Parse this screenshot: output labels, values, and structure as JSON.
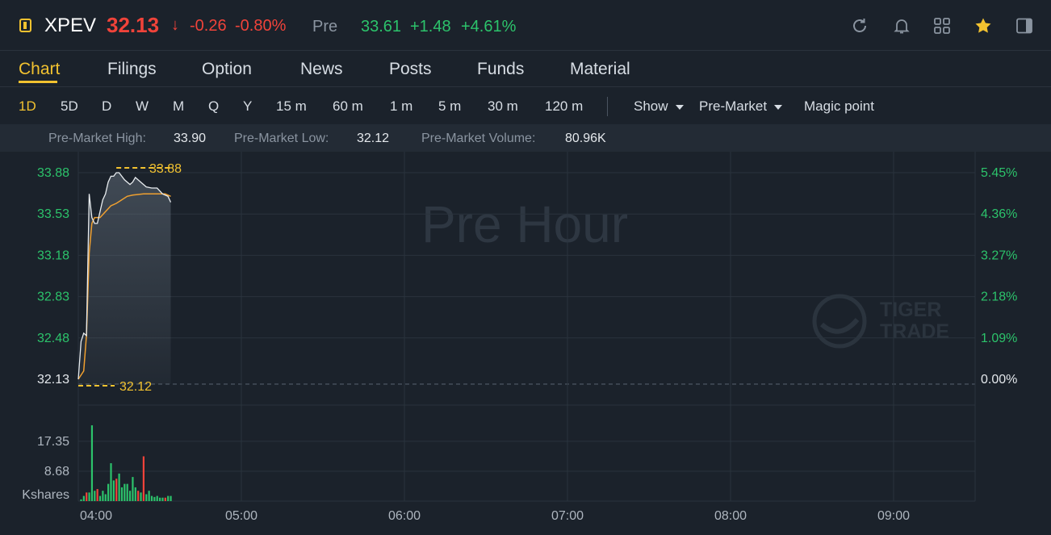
{
  "header": {
    "symbol": "XPEV",
    "price": "32.13",
    "price_arrow": "↓",
    "change": "-0.26",
    "change_pct": "-0.80%",
    "session_label": "Pre",
    "pre_price": "33.61",
    "pre_change": "+1.48",
    "pre_change_pct": "+4.61%",
    "icons": [
      "refresh-icon",
      "bell-icon",
      "grid-icon",
      "star-icon",
      "sidebar-toggle-icon"
    ]
  },
  "tabs": [
    "Chart",
    "Filings",
    "Option",
    "News",
    "Posts",
    "Funds",
    "Material"
  ],
  "active_tab": "Chart",
  "periods": [
    "1D",
    "5D",
    "D",
    "W",
    "M",
    "Q",
    "Y",
    "15 m",
    "60 m",
    "1 m",
    "5 m",
    "30 m",
    "120 m"
  ],
  "active_period": "1D",
  "controls": {
    "show": "Show",
    "session": "Pre-Market",
    "magic": "Magic point"
  },
  "stats": {
    "high_label": "Pre-Market High:",
    "high_value": "33.90",
    "low_label": "Pre-Market Low:",
    "low_value": "32.12",
    "volume_label": "Pre-Market Volume:",
    "volume_value": "80.96K"
  },
  "watermark": "Pre Hour",
  "logo_text": [
    "TIGER",
    "TRADE"
  ],
  "colors": {
    "up": "#2cc36b",
    "down": "#f0433a",
    "accent": "#f2c230",
    "background": "#1b222b",
    "avg_line": "#f0a030"
  },
  "chart_data": {
    "type": "line",
    "x_ticks": [
      "04:00",
      "05:00",
      "06:00",
      "07:00",
      "08:00",
      "09:00"
    ],
    "y_ticks": [
      "33.88",
      "33.53",
      "33.18",
      "32.83",
      "32.48",
      "32.13"
    ],
    "pct_ticks": [
      "5.45%",
      "4.36%",
      "3.27%",
      "2.18%",
      "1.09%",
      "0.00%"
    ],
    "ylim": [
      32.13,
      33.88
    ],
    "xlim_minutes": [
      0,
      330
    ],
    "high_marker": "33.88",
    "low_marker": "32.12",
    "series": [
      {
        "name": "price",
        "points": [
          [
            0,
            32.13
          ],
          [
            1,
            32.45
          ],
          [
            2,
            32.52
          ],
          [
            3,
            32.5
          ],
          [
            4,
            33.7
          ],
          [
            5,
            33.5
          ],
          [
            6,
            33.45
          ],
          [
            7,
            33.45
          ],
          [
            8,
            33.55
          ],
          [
            9,
            33.65
          ],
          [
            10,
            33.7
          ],
          [
            11,
            33.8
          ],
          [
            12,
            33.85
          ],
          [
            13,
            33.85
          ],
          [
            14,
            33.88
          ],
          [
            15,
            33.88
          ],
          [
            17,
            33.82
          ],
          [
            19,
            33.78
          ],
          [
            20,
            33.8
          ],
          [
            21,
            33.84
          ],
          [
            23,
            33.8
          ],
          [
            25,
            33.76
          ],
          [
            27,
            33.75
          ],
          [
            29,
            33.75
          ],
          [
            31,
            33.7
          ],
          [
            33,
            33.68
          ],
          [
            34,
            33.63
          ]
        ]
      },
      {
        "name": "average",
        "points": [
          [
            0,
            32.13
          ],
          [
            2,
            32.2
          ],
          [
            3,
            32.5
          ],
          [
            4,
            33.2
          ],
          [
            5,
            33.45
          ],
          [
            6,
            33.5
          ],
          [
            8,
            33.5
          ],
          [
            10,
            33.55
          ],
          [
            12,
            33.6
          ],
          [
            14,
            33.62
          ],
          [
            16,
            33.65
          ],
          [
            18,
            33.68
          ],
          [
            20,
            33.69
          ],
          [
            24,
            33.7
          ],
          [
            28,
            33.7
          ],
          [
            32,
            33.7
          ],
          [
            34,
            33.68
          ]
        ]
      }
    ],
    "volume": {
      "label": "Kshares",
      "ticks": [
        "17.35",
        "8.68"
      ],
      "ylim": [
        0,
        26
      ],
      "bars": [
        [
          1,
          0.5,
          "up"
        ],
        [
          2,
          1.5,
          "up"
        ],
        [
          3,
          2.5,
          "down"
        ],
        [
          4,
          2.5,
          "up"
        ],
        [
          5,
          22,
          "up"
        ],
        [
          6,
          3,
          "up"
        ],
        [
          7,
          3.5,
          "down"
        ],
        [
          8,
          1.5,
          "up"
        ],
        [
          9,
          3,
          "up"
        ],
        [
          10,
          2,
          "up"
        ],
        [
          11,
          5,
          "up"
        ],
        [
          12,
          11,
          "up"
        ],
        [
          13,
          6,
          "up"
        ],
        [
          14,
          6.5,
          "down"
        ],
        [
          15,
          8,
          "up"
        ],
        [
          16,
          4,
          "up"
        ],
        [
          17,
          5,
          "up"
        ],
        [
          18,
          5,
          "up"
        ],
        [
          19,
          3,
          "up"
        ],
        [
          20,
          7,
          "up"
        ],
        [
          21,
          4,
          "up"
        ],
        [
          22,
          3,
          "down"
        ],
        [
          23,
          2.5,
          "up"
        ],
        [
          24,
          13,
          "down"
        ],
        [
          25,
          2,
          "up"
        ],
        [
          26,
          3,
          "up"
        ],
        [
          27,
          1.5,
          "up"
        ],
        [
          28,
          1.2,
          "up"
        ],
        [
          29,
          1.5,
          "up"
        ],
        [
          30,
          1,
          "up"
        ],
        [
          31,
          1,
          "up"
        ],
        [
          32,
          1,
          "down"
        ],
        [
          33,
          1.5,
          "up"
        ],
        [
          34,
          1.5,
          "up"
        ]
      ]
    }
  }
}
